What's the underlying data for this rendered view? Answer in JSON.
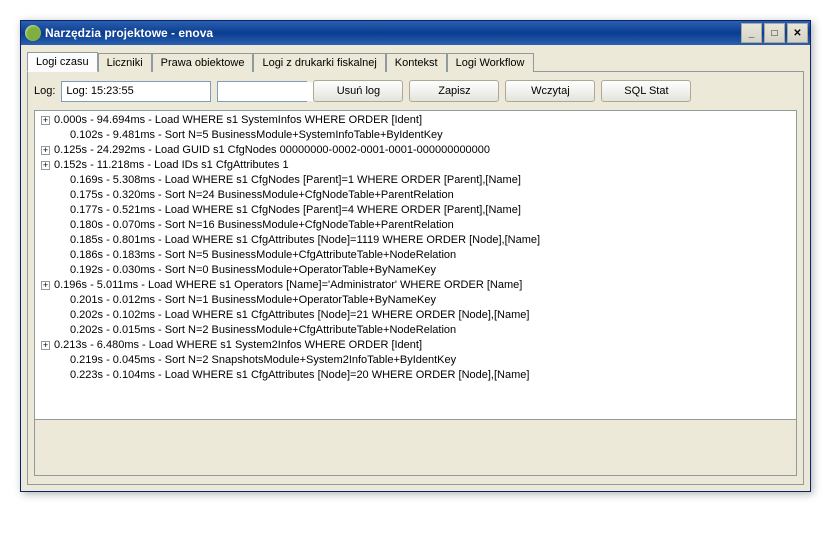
{
  "window": {
    "title": "Narzędzia projektowe - enova"
  },
  "tabs": [
    {
      "label": "Logi czasu",
      "active": true
    },
    {
      "label": "Liczniki",
      "active": false
    },
    {
      "label": "Prawa obiektowe",
      "active": false
    },
    {
      "label": "Logi z drukarki fiskalnej",
      "active": false
    },
    {
      "label": "Kontekst",
      "active": false
    },
    {
      "label": "Logi Workflow",
      "active": false
    }
  ],
  "toolbar": {
    "log_label": "Log:",
    "log_value": "Log: 15:23:55",
    "filter_value": "",
    "delete_button": "Usuń log",
    "save_button": "Zapisz",
    "load_button": "Wczytaj",
    "sqlstat_button": "SQL Stat"
  },
  "log_rows": [
    {
      "expandable": true,
      "indent": 0,
      "text": "0.000s - 94.694ms - Load WHERE s1 SystemInfos  WHERE  ORDER [Ident]"
    },
    {
      "expandable": false,
      "indent": 1,
      "text": "0.102s - 9.481ms - Sort N=5 BusinessModule+SystemInfoTable+ByIdentKey"
    },
    {
      "expandable": true,
      "indent": 0,
      "text": "0.125s - 24.292ms - Load GUID s1 CfgNodes 00000000-0002-0001-0001-000000000000"
    },
    {
      "expandable": true,
      "indent": 0,
      "text": "0.152s - 11.218ms - Load IDs s1 CfgAttributes 1"
    },
    {
      "expandable": false,
      "indent": 1,
      "text": "0.169s - 5.308ms - Load WHERE s1 CfgNodes [Parent]=1 WHERE  ORDER [Parent],[Name]"
    },
    {
      "expandable": false,
      "indent": 1,
      "text": "0.175s - 0.320ms - Sort N=24 BusinessModule+CfgNodeTable+ParentRelation"
    },
    {
      "expandable": false,
      "indent": 1,
      "text": "0.177s - 0.521ms - Load WHERE s1 CfgNodes [Parent]=4 WHERE  ORDER [Parent],[Name]"
    },
    {
      "expandable": false,
      "indent": 1,
      "text": "0.180s - 0.070ms - Sort N=16 BusinessModule+CfgNodeTable+ParentRelation"
    },
    {
      "expandable": false,
      "indent": 1,
      "text": "0.185s - 0.801ms - Load WHERE s1 CfgAttributes [Node]=1119 WHERE  ORDER [Node],[Name]"
    },
    {
      "expandable": false,
      "indent": 1,
      "text": "0.186s - 0.183ms - Sort N=5 BusinessModule+CfgAttributeTable+NodeRelation"
    },
    {
      "expandable": false,
      "indent": 1,
      "text": "0.192s - 0.030ms - Sort N=0 BusinessModule+OperatorTable+ByNameKey"
    },
    {
      "expandable": true,
      "indent": 0,
      "text": "0.196s - 5.011ms - Load WHERE s1 Operators [Name]='Administrator' WHERE  ORDER [Name]"
    },
    {
      "expandable": false,
      "indent": 1,
      "text": "0.201s - 0.012ms - Sort N=1 BusinessModule+OperatorTable+ByNameKey"
    },
    {
      "expandable": false,
      "indent": 1,
      "text": "0.202s - 0.102ms - Load WHERE s1 CfgAttributes [Node]=21 WHERE  ORDER [Node],[Name]"
    },
    {
      "expandable": false,
      "indent": 1,
      "text": "0.202s - 0.015ms - Sort N=2 BusinessModule+CfgAttributeTable+NodeRelation"
    },
    {
      "expandable": true,
      "indent": 0,
      "text": "0.213s - 6.480ms - Load WHERE s1 System2Infos  WHERE  ORDER [Ident]"
    },
    {
      "expandable": false,
      "indent": 1,
      "text": "0.219s - 0.045ms - Sort N=2 SnapshotsModule+System2InfoTable+ByIdentKey"
    },
    {
      "expandable": false,
      "indent": 1,
      "text": "0.223s - 0.104ms - Load WHERE s1 CfgAttributes [Node]=20 WHERE  ORDER [Node],[Name]"
    }
  ]
}
